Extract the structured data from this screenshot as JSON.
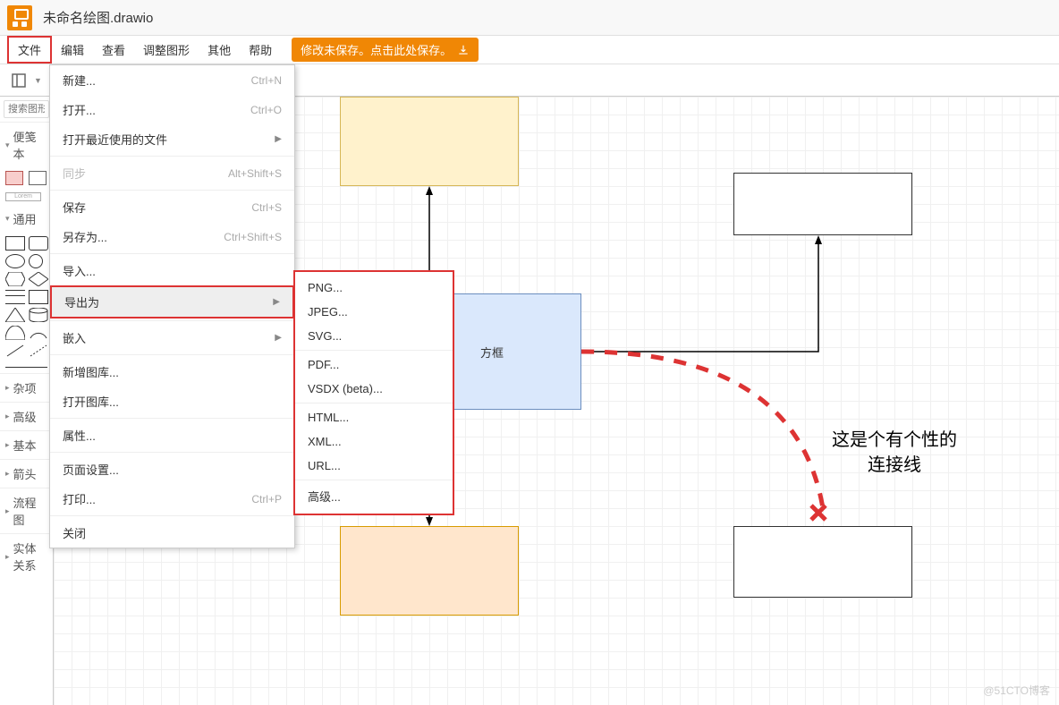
{
  "title": "未命名绘图.drawio",
  "menubar": [
    "文件",
    "编辑",
    "查看",
    "调整图形",
    "其他",
    "帮助"
  ],
  "save_notice": "修改未保存。点击此处保存。",
  "search_placeholder": "搜索图形",
  "side": {
    "scratch": "便笺本",
    "general": "通用",
    "misc": "杂项",
    "advanced": "高级",
    "basic": "基本",
    "arrows": "箭头",
    "flowchart": "流程图",
    "er": "实体关系"
  },
  "file_menu": [
    {
      "label": "新建...",
      "shortcut": "Ctrl+N"
    },
    {
      "label": "打开...",
      "shortcut": "Ctrl+O"
    },
    {
      "label": "打开最近使用的文件",
      "sub": true
    },
    {
      "sep": true
    },
    {
      "label": "同步",
      "shortcut": "Alt+Shift+S",
      "disabled": true
    },
    {
      "sep": true
    },
    {
      "label": "保存",
      "shortcut": "Ctrl+S"
    },
    {
      "label": "另存为...",
      "shortcut": "Ctrl+Shift+S"
    },
    {
      "sep": true
    },
    {
      "label": "导入..."
    },
    {
      "label": "导出为",
      "sub": true,
      "hl": true,
      "red": true
    },
    {
      "sep": true
    },
    {
      "label": "嵌入",
      "sub": true
    },
    {
      "sep": true
    },
    {
      "label": "新增图库..."
    },
    {
      "label": "打开图库..."
    },
    {
      "sep": true
    },
    {
      "label": "属性..."
    },
    {
      "sep": true
    },
    {
      "label": "页面设置..."
    },
    {
      "label": "打印...",
      "shortcut": "Ctrl+P"
    },
    {
      "sep": true
    },
    {
      "label": "关闭"
    }
  ],
  "export_menu": [
    "PNG...",
    "JPEG...",
    "SVG...",
    "",
    "PDF...",
    "VSDX (beta)...",
    "",
    "HTML...",
    "XML...",
    "URL...",
    "",
    "高级..."
  ],
  "canvas": {
    "center_label": "方框",
    "annotation": "这是个有个性的\n连接线"
  },
  "watermark": "@51CTO博客"
}
